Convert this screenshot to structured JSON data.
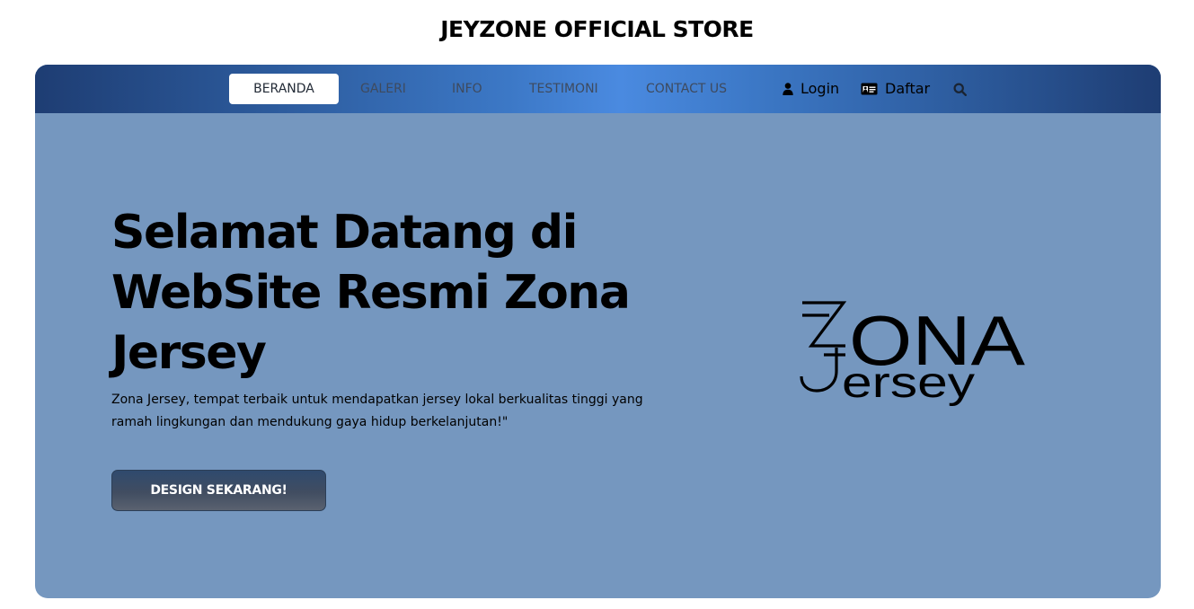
{
  "store": {
    "title": "JEYZONE OFFICIAL STORE"
  },
  "nav": {
    "items": [
      {
        "label": "BERANDA",
        "active": true
      },
      {
        "label": "GALERI",
        "active": false
      },
      {
        "label": "INFO",
        "active": false
      },
      {
        "label": "TESTIMONI",
        "active": false
      },
      {
        "label": "CONTACT US",
        "active": false
      }
    ],
    "login_label": "Login",
    "register_label": "Daftar",
    "icons": {
      "login": "user-icon",
      "register": "id-card-icon",
      "search": "search-icon"
    }
  },
  "hero": {
    "title": "Selamat Datang di WebSite Resmi Zona Jersey",
    "description": "Zona Jersey, tempat terbaik untuk mendapatkan jersey lokal berkualitas tinggi yang ramah lingkungan dan mendukung gaya hidup berkelanjutan!\"",
    "cta_label": "DESIGN SEKARANG!"
  },
  "logo": {
    "word_top": "ONA",
    "word_bottom": "ersey",
    "monogram": "ZJ"
  },
  "colors": {
    "hero_bg": "#7597bf",
    "nav_dark": "#1e3d73",
    "nav_light": "#4a8ae0",
    "cta_bg": "#414d61"
  }
}
